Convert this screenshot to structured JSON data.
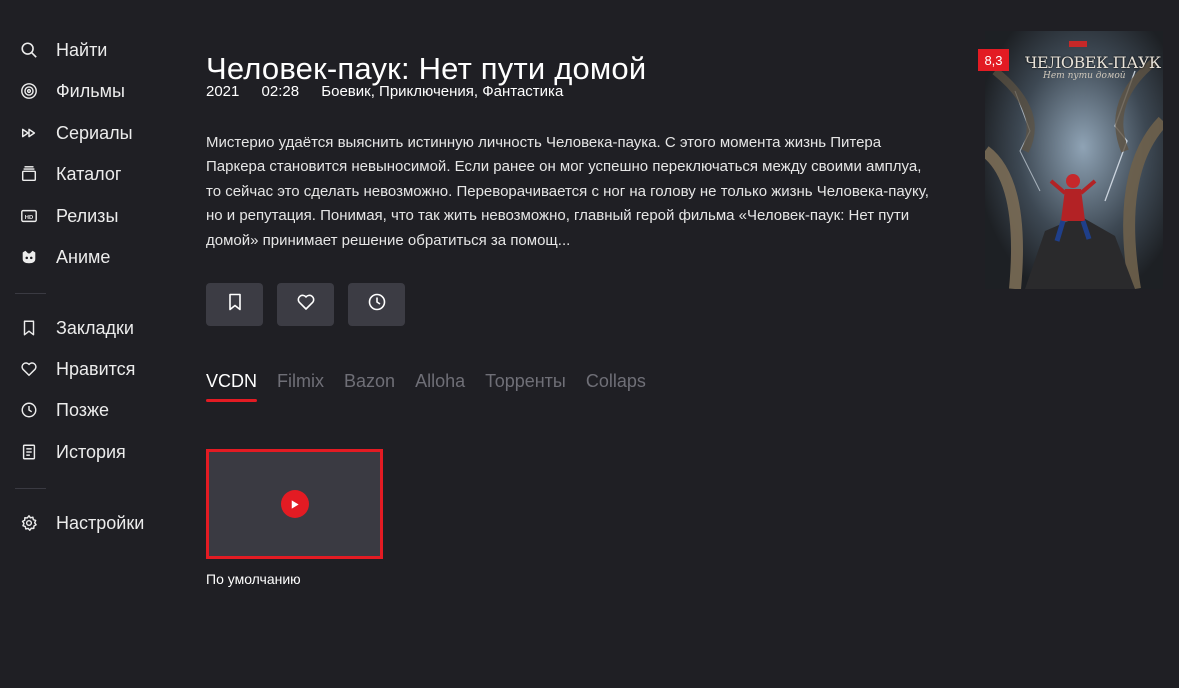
{
  "sidebar": {
    "items": [
      {
        "label": "Найти",
        "icon": "search-icon"
      },
      {
        "label": "Фильмы",
        "icon": "film-reel-icon"
      },
      {
        "label": "Сериалы",
        "icon": "fast-forward-icon"
      },
      {
        "label": "Каталог",
        "icon": "catalog-icon"
      },
      {
        "label": "Релизы",
        "icon": "hd-icon"
      },
      {
        "label": "Аниме",
        "icon": "anime-icon"
      },
      {
        "label": "Закладки",
        "icon": "bookmark-icon"
      },
      {
        "label": "Нравится",
        "icon": "heart-icon"
      },
      {
        "label": "Позже",
        "icon": "clock-icon"
      },
      {
        "label": "История",
        "icon": "history-icon"
      },
      {
        "label": "Настройки",
        "icon": "gear-icon"
      }
    ]
  },
  "movie": {
    "title": "Человек-паук: Нет пути домой",
    "year": "2021",
    "duration": "02:28",
    "genres": "Боевик, Приключения, Фантастика",
    "description": "Мистерио удаётся выяснить истинную личность Человека-паука. С этого момента жизнь Питера Паркера становится невыносимой. Если ранее он мог успешно переключаться между своими амплуа, то сейчас это сделать невозможно. Переворачивается с ног на голову не только жизнь Человека-пауку, но и репутация. Понимая, что так жить невозможно, главный герой фильма «Человек-паук: Нет пути домой» принимает решение обратиться за помощ...",
    "rating": "8,3",
    "poster": {
      "title": "ЧЕЛОВЕК-ПАУК",
      "subtitle": "Нет пути домой"
    }
  },
  "actions": [
    {
      "icon": "bookmark-icon"
    },
    {
      "icon": "heart-icon"
    },
    {
      "icon": "clock-icon"
    }
  ],
  "tabs": [
    "VCDN",
    "Filmix",
    "Bazon",
    "Alloha",
    "Торренты",
    "Collaps"
  ],
  "active_tab": "VCDN",
  "source": {
    "label": "По умолчанию"
  },
  "colors": {
    "accent": "#e31b23",
    "background": "#1f1f24",
    "button": "#3c3c44"
  }
}
